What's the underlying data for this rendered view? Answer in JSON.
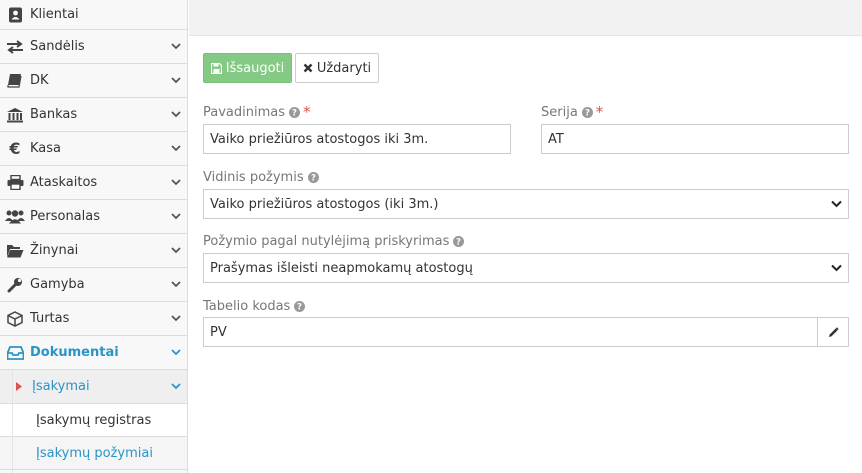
{
  "sidebar": {
    "items": [
      {
        "label": "Klientai",
        "icon": "client-card-icon"
      },
      {
        "label": "Sandėlis",
        "icon": "exchange-arrows-icon"
      },
      {
        "label": "DK",
        "icon": "book-icon"
      },
      {
        "label": "Bankas",
        "icon": "bank-icon"
      },
      {
        "label": "Kasa",
        "icon": "euro-icon"
      },
      {
        "label": "Ataskaitos",
        "icon": "printer-icon"
      },
      {
        "label": "Personalas",
        "icon": "users-icon"
      },
      {
        "label": "Žinynai",
        "icon": "folder-open-icon"
      },
      {
        "label": "Gamyba",
        "icon": "wrench-icon"
      },
      {
        "label": "Turtas",
        "icon": "cube-icon"
      },
      {
        "label": "Dokumentai",
        "icon": "inbox-icon"
      }
    ],
    "sub_item": {
      "label": "Įsakymai"
    },
    "sub_sub_items": [
      {
        "label": "Įsakymų registras"
      },
      {
        "label": "Įsakymų požymiai"
      }
    ]
  },
  "toolbar": {
    "save_label": "Išsaugoti",
    "close_label": "Uždaryti"
  },
  "form": {
    "name_label": "Pavadinimas",
    "name_value": "Vaiko priežiūros atostogos iki 3m.",
    "series_label": "Serija",
    "series_value": "AT",
    "internal_label": "Vidinis požymis",
    "internal_value": "Vaiko priežiūros atostogos (iki 3m.)",
    "default_label": "Požymio pagal nutylėjimą priskyrimas",
    "default_value": "Prašymas išleisti neapmokamų atostogų",
    "timesheet_label": "Tabelio kodas",
    "timesheet_value": "PV",
    "required_mark": "*"
  },
  "colors": {
    "accent": "#2a94c6",
    "save": "#5cb85c",
    "required": "#d9534f"
  }
}
